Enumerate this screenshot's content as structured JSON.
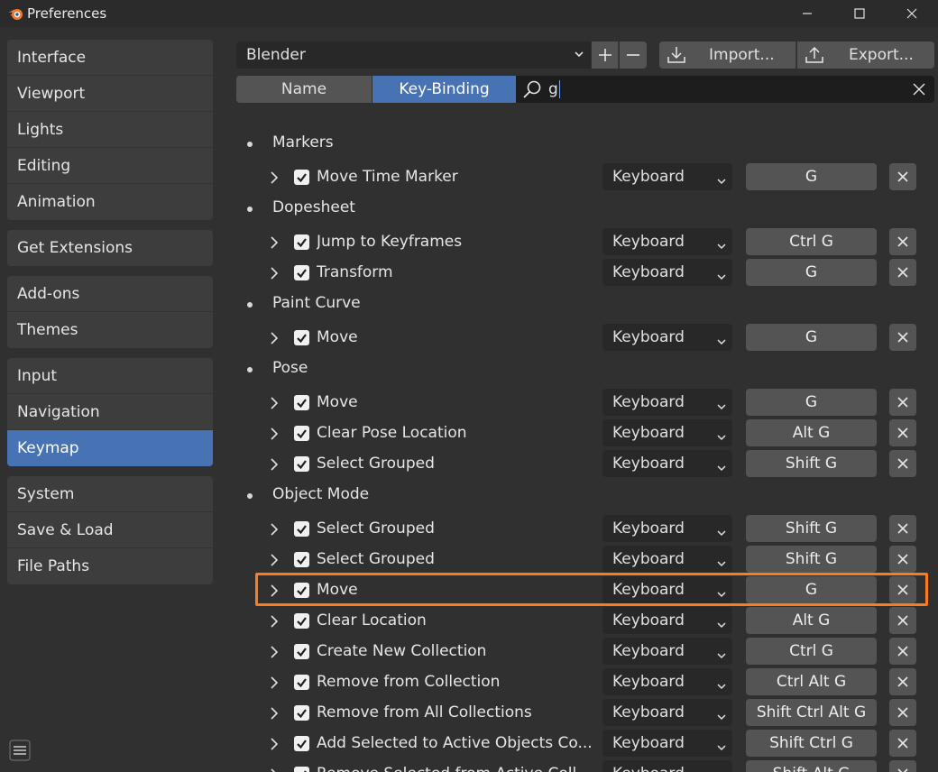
{
  "window": {
    "title": "Preferences",
    "app_icon": "blender-logo-icon",
    "controls": [
      "minimize-icon",
      "maximize-icon",
      "close-icon"
    ]
  },
  "sidebar": {
    "groups": [
      [
        {
          "label": "Interface"
        },
        {
          "label": "Viewport"
        },
        {
          "label": "Lights"
        },
        {
          "label": "Editing"
        },
        {
          "label": "Animation"
        }
      ],
      [
        {
          "label": "Get Extensions"
        }
      ],
      [
        {
          "label": "Add-ons"
        },
        {
          "label": "Themes"
        }
      ],
      [
        {
          "label": "Input"
        },
        {
          "label": "Navigation"
        },
        {
          "label": "Keymap",
          "active": true
        }
      ],
      [
        {
          "label": "System"
        },
        {
          "label": "Save & Load"
        },
        {
          "label": "File Paths"
        }
      ]
    ]
  },
  "toolbar": {
    "preset": "Blender",
    "import_label": "Import...",
    "export_label": "Export..."
  },
  "search": {
    "mode_name": "Name",
    "mode_keybinding": "Key-Binding",
    "active_mode": "Key-Binding",
    "query": "g"
  },
  "keymap": [
    {
      "category": "Markers",
      "items": [
        {
          "name": "Move Time Marker",
          "device": "Keyboard",
          "key": "G"
        }
      ]
    },
    {
      "category": "Dopesheet",
      "items": [
        {
          "name": "Jump to Keyframes",
          "device": "Keyboard",
          "key": "Ctrl G"
        },
        {
          "name": "Transform",
          "device": "Keyboard",
          "key": "G"
        }
      ]
    },
    {
      "category": "Paint Curve",
      "items": [
        {
          "name": "Move",
          "device": "Keyboard",
          "key": "G"
        }
      ]
    },
    {
      "category": "Pose",
      "items": [
        {
          "name": "Move",
          "device": "Keyboard",
          "key": "G"
        },
        {
          "name": "Clear Pose Location",
          "device": "Keyboard",
          "key": "Alt G"
        },
        {
          "name": "Select Grouped",
          "device": "Keyboard",
          "key": "Shift G"
        }
      ]
    },
    {
      "category": "Object Mode",
      "items": [
        {
          "name": "Select Grouped",
          "device": "Keyboard",
          "key": "Shift G"
        },
        {
          "name": "Select Grouped",
          "device": "Keyboard",
          "key": "Shift G"
        },
        {
          "name": "Move",
          "device": "Keyboard",
          "key": "G",
          "highlighted": true
        },
        {
          "name": "Clear Location",
          "device": "Keyboard",
          "key": "Alt G"
        },
        {
          "name": "Create New Collection",
          "device": "Keyboard",
          "key": "Ctrl G"
        },
        {
          "name": "Remove from Collection",
          "device": "Keyboard",
          "key": "Ctrl Alt G"
        },
        {
          "name": "Remove from All Collections",
          "device": "Keyboard",
          "key": "Shift Ctrl Alt G"
        },
        {
          "name": "Add Selected to Active Objects Co...",
          "device": "Keyboard",
          "key": "Shift Ctrl G"
        },
        {
          "name": "Remove Selected from Active Coll...",
          "device": "Keyboard",
          "key": "Shift Alt G"
        }
      ]
    }
  ],
  "colors": {
    "accent": "#4772b3",
    "highlight_outline": "#ff7a1a",
    "background": "#303030"
  }
}
